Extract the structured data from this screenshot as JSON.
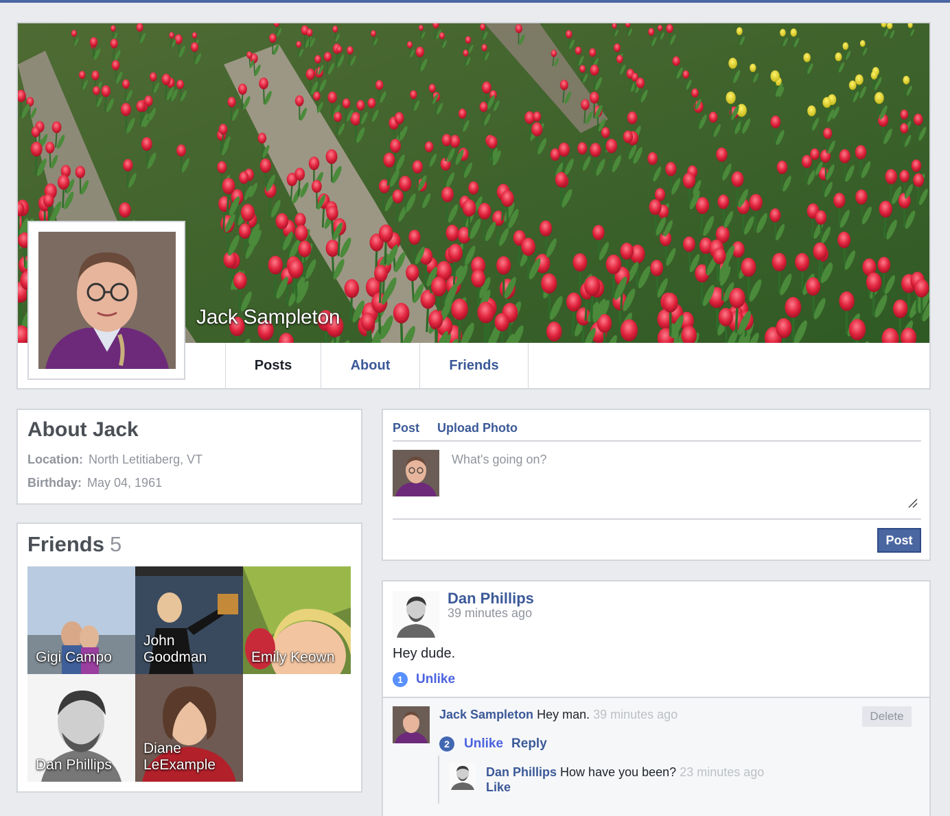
{
  "profile": {
    "name": "Jack Sampleton",
    "tabs": [
      "Posts",
      "About",
      "Friends"
    ]
  },
  "about": {
    "title": "About Jack",
    "location_label": "Location:",
    "location": "North Letitiaberg, VT",
    "birthday_label": "Birthday:",
    "birthday": "May 04, 1961"
  },
  "friends": {
    "title": "Friends",
    "count": "5",
    "items": [
      "Gigi Campo",
      "John Goodman",
      "Emily Keown",
      "Dan Phillips",
      "Diane LeExample"
    ]
  },
  "composer": {
    "tab_post": "Post",
    "tab_upload": "Upload Photo",
    "placeholder": "What's going on?",
    "submit": "Post"
  },
  "post": {
    "author": "Dan Phillips",
    "time": "39 minutes ago",
    "body": "Hey dude.",
    "like_count": "1",
    "unlike_label": "Unlike"
  },
  "comment": {
    "author": "Jack Sampleton",
    "text": "Hey man.",
    "time": "39 minutes ago",
    "delete_label": "Delete",
    "like_count": "2",
    "unlike_label": "Unlike",
    "reply_label": "Reply"
  },
  "reply": {
    "author": "Dan Phillips",
    "text": "How have you been?",
    "time": "23 minutes ago",
    "like_label": "Like"
  },
  "colors": {
    "accent": "#3b5998",
    "background": "#e9ebee",
    "button": "#4b67a1",
    "like_badge": "#5890ff"
  }
}
